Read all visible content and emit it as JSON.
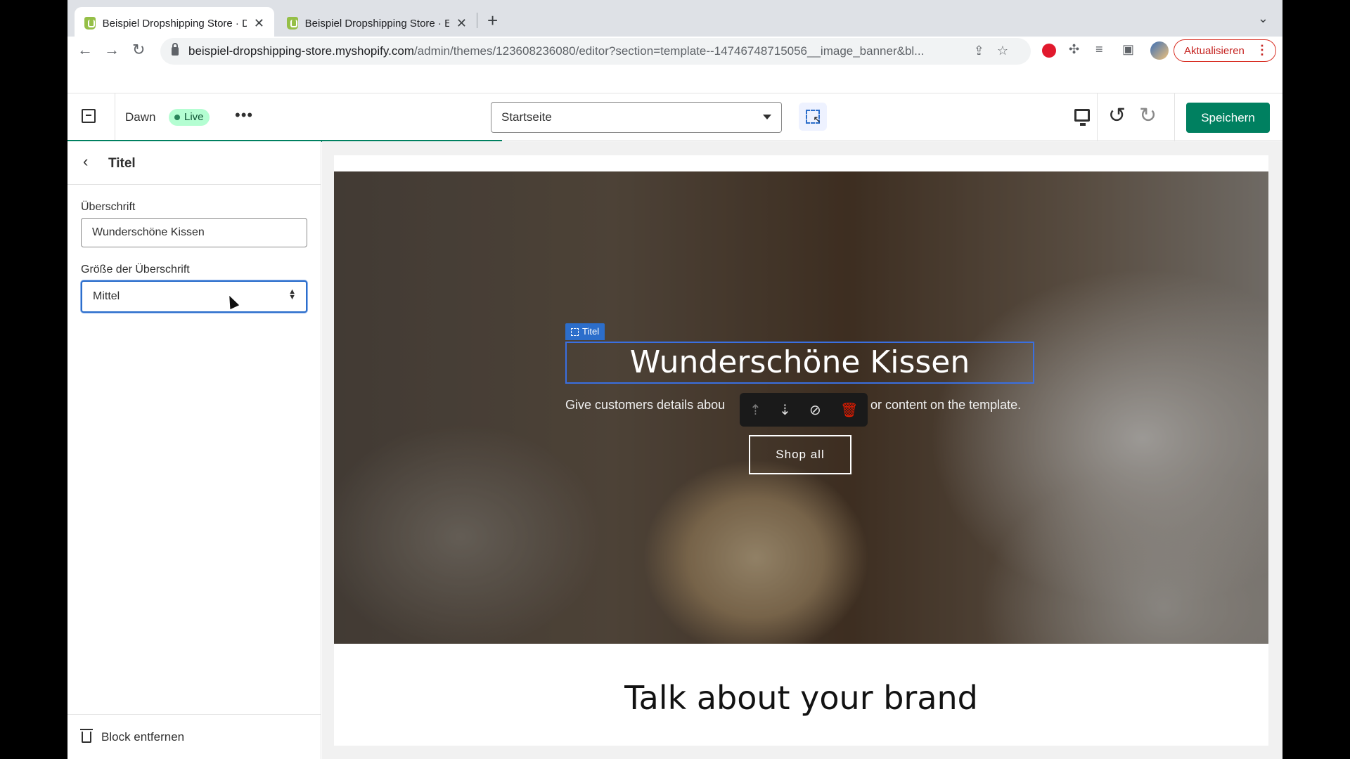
{
  "browser": {
    "tabs": [
      {
        "title": "Beispiel Dropshipping Store · D",
        "close": "✕"
      },
      {
        "title": "Beispiel Dropshipping Store · E",
        "close": "✕"
      }
    ],
    "new_tab": "+",
    "url_host": "beispiel-dropshipping-store.myshopify.com",
    "url_path": "/admin/themes/123608236080/editor?section=template--14746748715056__image_banner&bl...",
    "update_button": "Aktualisieren"
  },
  "editor": {
    "theme_name": "Dawn",
    "live_badge": "Live",
    "page_select": "Startseite",
    "save_label": "Speichern"
  },
  "sidebar": {
    "title": "Titel",
    "heading_label": "Überschrift",
    "heading_value": "Wunderschöne Kissen",
    "size_label": "Größe der Überschrift",
    "size_value": "Mittel",
    "remove_block": "Block entfernen"
  },
  "preview": {
    "block_tag": "Titel",
    "hero_heading": "Wunderschöne Kissen",
    "hero_sub_left": "Give customers details abou",
    "hero_sub_right": "or content on the template.",
    "hero_button": "Shop all",
    "brand_heading": "Talk about your brand"
  },
  "colors": {
    "primary": "#008060",
    "selection": "#2c6ecb",
    "live_bg": "#b4fed2"
  }
}
